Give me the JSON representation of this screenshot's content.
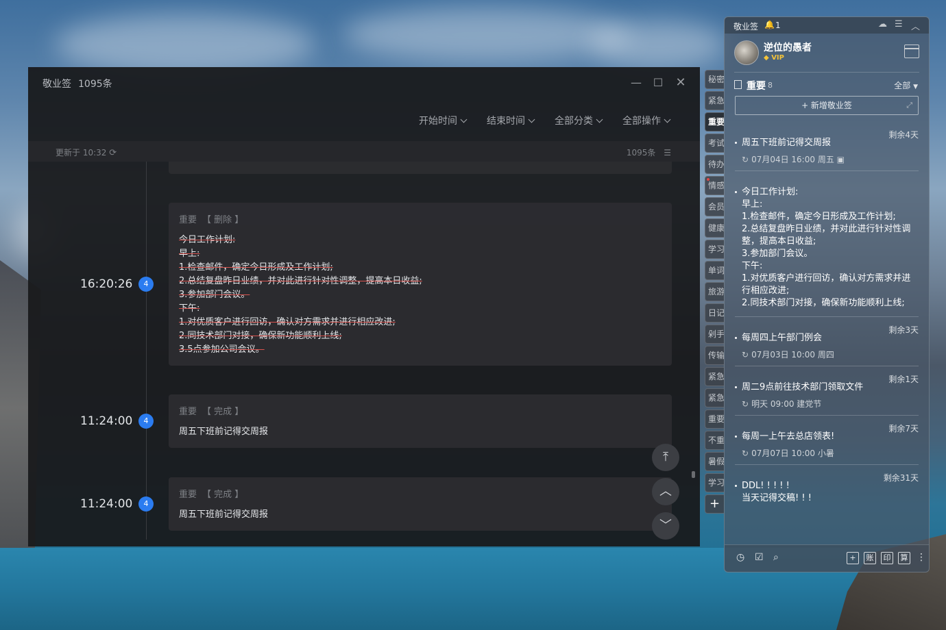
{
  "main": {
    "app_name": "敬业签",
    "count_label": "1095条",
    "filters": [
      "开始时间",
      "结束时间",
      "全部分类",
      "全部操作"
    ],
    "updated_label": "更新于 10:32",
    "total_label": "1095条",
    "entries": [
      {
        "time": "16:20:26",
        "badge": "4",
        "category": "重要",
        "action": "【 删除 】",
        "lines": [
          "今日工作计划:",
          "早上:",
          "1.检查邮件，确定今日形成及工作计划;",
          "2.总结复盘昨日业绩，并对此进行针对性调整，提高本日收益;",
          "3.参加部门会议。",
          "下午:",
          "1.对优质客户进行回访，确认对方需求并进行相应改进;",
          "2.同技术部门对接，确保新功能顺利上线;",
          "3.5点参加公司会议。"
        ]
      },
      {
        "time": "11:24:00",
        "badge": "4",
        "category": "重要",
        "action": "【 完成 】",
        "text": "周五下班前记得交周报"
      },
      {
        "time": "11:24:00",
        "badge": "4",
        "category": "重要",
        "action": "【 完成 】",
        "text": "周五下班前记得交周报"
      }
    ]
  },
  "tabs": [
    "秘密",
    "紧急",
    "重要",
    "考试",
    "待办",
    "情感",
    "会员",
    "健康",
    "学习",
    "单词",
    "旅游",
    "日记",
    "剁手",
    "传输",
    "紧急",
    "紧急",
    "重要",
    "不重",
    "暑假",
    "学习"
  ],
  "note": {
    "app_name": "敬业签",
    "bell_count": "1",
    "username": "逆位的愚者",
    "vip": "VIP",
    "category": "重要",
    "category_count": "8",
    "filter": "全部",
    "new_button": "+ 新增敬业签",
    "items": [
      {
        "remain": "剩余4天",
        "text": "周五下班前记得交周报",
        "meta": "07月04日 16:00 周五"
      },
      {
        "remain": "",
        "text": "今日工作计划:\n早上:\n1.检查邮件，确定今日形成及工作计划;\n2.总结复盘昨日业绩，并对此进行针对性调整，提高本日收益;\n3.参加部门会议。\n下午:\n1.对优质客户进行回访，确认对方需求并进行相应改进;\n2.同技术部门对接，确保新功能顺利上线;",
        "meta": ""
      },
      {
        "remain": "剩余3天",
        "text": "每周四上午部门例会",
        "meta": "07月03日 10:00 周四"
      },
      {
        "remain": "剩余1天",
        "text": "周二9点前往技术部门领取文件",
        "meta": "明天 09:00 建党节"
      },
      {
        "remain": "剩余7天",
        "text": "每周一上午去总店领表!",
        "meta": "07月07日 10:00 小暑"
      },
      {
        "remain": "剩余31天",
        "text": "DDL! ! ! ! !\n当天记得交稿! ! !",
        "meta": ""
      }
    ],
    "bottom_boxes": [
      "+",
      "账",
      "印",
      "算"
    ]
  }
}
